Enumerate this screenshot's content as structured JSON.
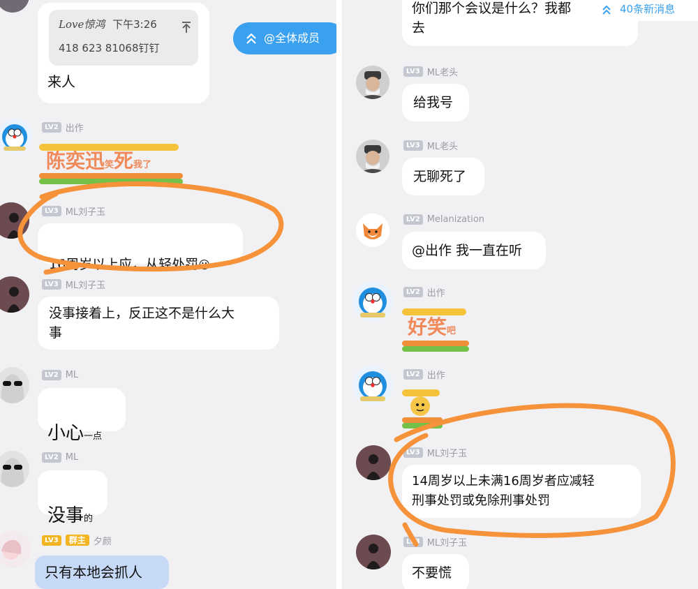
{
  "left": {
    "reply_card": {
      "sender": "Love惊鸿",
      "time": "下午3:26",
      "content": "418 623 81068钉钉"
    },
    "first_bubble": "来人",
    "mention_all_button": "@全体成员",
    "messages": [
      {
        "level": "LV2",
        "name": "出作",
        "sticker_main": "陈奕迅",
        "sticker_small_1": "笑",
        "sticker_main_2": "死",
        "sticker_small_2": "我了"
      },
      {
        "level": "LV3",
        "name": "ML刘子玉",
        "text": "16周岁以上应，从轻处罚",
        "emoji": "😶"
      },
      {
        "level": "LV3",
        "name": "ML刘子玉",
        "text": "没事接着上，反正这不是什么大\n事"
      },
      {
        "level": "LV2",
        "name": "ML",
        "big": "小心",
        "small": "一点"
      },
      {
        "level": "LV2",
        "name": "ML",
        "big": "没事",
        "small": "的"
      },
      {
        "level": "LV3",
        "role": "群主",
        "name": "夕颜",
        "text": "只有本地会抓人"
      }
    ]
  },
  "right": {
    "top_bubble": "你们那个会议是什么？我都\n去",
    "new_messages_badge": "40条新消息",
    "messages": [
      {
        "level": "LV3",
        "name": "ML老头",
        "text": "给我号"
      },
      {
        "level": "LV3",
        "name": "ML老头",
        "text": "无聊死了"
      },
      {
        "level": "LV2",
        "name": "Melanization",
        "text": "@出作 我一直在听"
      },
      {
        "level": "LV2",
        "name": "出作",
        "sticker_main": "好笑",
        "sticker_small": "吧"
      },
      {
        "level": "LV2",
        "name": "出作"
      },
      {
        "level": "LV3",
        "name": "ML刘子玉",
        "text": "14周岁以上未满16周岁者应减轻\n刑事处罚或免除刑事处罚"
      },
      {
        "level": "LV3",
        "name": "ML刘子玉",
        "text": "不要慌"
      }
    ]
  },
  "colors": {
    "background": "#f1f1f3",
    "bubble": "#ffffff",
    "accent_blue": "#3aa0f0",
    "annotation_orange": "#f5923a",
    "level_badge": "#c4c7d0"
  }
}
